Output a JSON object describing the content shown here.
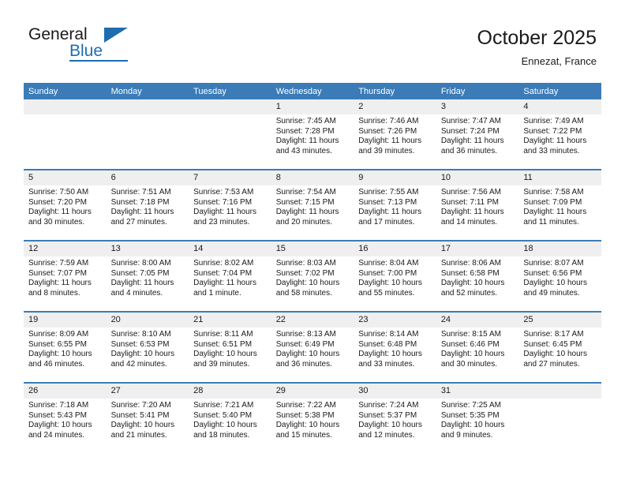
{
  "brand": {
    "name_part1": "General",
    "name_part2": "Blue",
    "accent_color": "#1f6cb0",
    "triangle_icon": "triangle-icon"
  },
  "header": {
    "month_title": "October 2025",
    "location": "Ennezat, France"
  },
  "theme": {
    "header_blue": "#3b7cb8",
    "daynum_gray": "#efefef",
    "text_color": "#1a1a1a"
  },
  "weekday_headers": [
    "Sunday",
    "Monday",
    "Tuesday",
    "Wednesday",
    "Thursday",
    "Friday",
    "Saturday"
  ],
  "calendar": {
    "weeks": [
      [
        {
          "day": "",
          "sunrise": "",
          "sunset": "",
          "daylight1": "",
          "daylight2": "",
          "empty": true
        },
        {
          "day": "",
          "sunrise": "",
          "sunset": "",
          "daylight1": "",
          "daylight2": "",
          "empty": true
        },
        {
          "day": "",
          "sunrise": "",
          "sunset": "",
          "daylight1": "",
          "daylight2": "",
          "empty": true
        },
        {
          "day": "1",
          "sunrise": "Sunrise: 7:45 AM",
          "sunset": "Sunset: 7:28 PM",
          "daylight1": "Daylight: 11 hours",
          "daylight2": "and 43 minutes."
        },
        {
          "day": "2",
          "sunrise": "Sunrise: 7:46 AM",
          "sunset": "Sunset: 7:26 PM",
          "daylight1": "Daylight: 11 hours",
          "daylight2": "and 39 minutes."
        },
        {
          "day": "3",
          "sunrise": "Sunrise: 7:47 AM",
          "sunset": "Sunset: 7:24 PM",
          "daylight1": "Daylight: 11 hours",
          "daylight2": "and 36 minutes."
        },
        {
          "day": "4",
          "sunrise": "Sunrise: 7:49 AM",
          "sunset": "Sunset: 7:22 PM",
          "daylight1": "Daylight: 11 hours",
          "daylight2": "and 33 minutes."
        }
      ],
      [
        {
          "day": "5",
          "sunrise": "Sunrise: 7:50 AM",
          "sunset": "Sunset: 7:20 PM",
          "daylight1": "Daylight: 11 hours",
          "daylight2": "and 30 minutes."
        },
        {
          "day": "6",
          "sunrise": "Sunrise: 7:51 AM",
          "sunset": "Sunset: 7:18 PM",
          "daylight1": "Daylight: 11 hours",
          "daylight2": "and 27 minutes."
        },
        {
          "day": "7",
          "sunrise": "Sunrise: 7:53 AM",
          "sunset": "Sunset: 7:16 PM",
          "daylight1": "Daylight: 11 hours",
          "daylight2": "and 23 minutes."
        },
        {
          "day": "8",
          "sunrise": "Sunrise: 7:54 AM",
          "sunset": "Sunset: 7:15 PM",
          "daylight1": "Daylight: 11 hours",
          "daylight2": "and 20 minutes."
        },
        {
          "day": "9",
          "sunrise": "Sunrise: 7:55 AM",
          "sunset": "Sunset: 7:13 PM",
          "daylight1": "Daylight: 11 hours",
          "daylight2": "and 17 minutes."
        },
        {
          "day": "10",
          "sunrise": "Sunrise: 7:56 AM",
          "sunset": "Sunset: 7:11 PM",
          "daylight1": "Daylight: 11 hours",
          "daylight2": "and 14 minutes."
        },
        {
          "day": "11",
          "sunrise": "Sunrise: 7:58 AM",
          "sunset": "Sunset: 7:09 PM",
          "daylight1": "Daylight: 11 hours",
          "daylight2": "and 11 minutes."
        }
      ],
      [
        {
          "day": "12",
          "sunrise": "Sunrise: 7:59 AM",
          "sunset": "Sunset: 7:07 PM",
          "daylight1": "Daylight: 11 hours",
          "daylight2": "and 8 minutes."
        },
        {
          "day": "13",
          "sunrise": "Sunrise: 8:00 AM",
          "sunset": "Sunset: 7:05 PM",
          "daylight1": "Daylight: 11 hours",
          "daylight2": "and 4 minutes."
        },
        {
          "day": "14",
          "sunrise": "Sunrise: 8:02 AM",
          "sunset": "Sunset: 7:04 PM",
          "daylight1": "Daylight: 11 hours",
          "daylight2": "and 1 minute."
        },
        {
          "day": "15",
          "sunrise": "Sunrise: 8:03 AM",
          "sunset": "Sunset: 7:02 PM",
          "daylight1": "Daylight: 10 hours",
          "daylight2": "and 58 minutes."
        },
        {
          "day": "16",
          "sunrise": "Sunrise: 8:04 AM",
          "sunset": "Sunset: 7:00 PM",
          "daylight1": "Daylight: 10 hours",
          "daylight2": "and 55 minutes."
        },
        {
          "day": "17",
          "sunrise": "Sunrise: 8:06 AM",
          "sunset": "Sunset: 6:58 PM",
          "daylight1": "Daylight: 10 hours",
          "daylight2": "and 52 minutes."
        },
        {
          "day": "18",
          "sunrise": "Sunrise: 8:07 AM",
          "sunset": "Sunset: 6:56 PM",
          "daylight1": "Daylight: 10 hours",
          "daylight2": "and 49 minutes."
        }
      ],
      [
        {
          "day": "19",
          "sunrise": "Sunrise: 8:09 AM",
          "sunset": "Sunset: 6:55 PM",
          "daylight1": "Daylight: 10 hours",
          "daylight2": "and 46 minutes."
        },
        {
          "day": "20",
          "sunrise": "Sunrise: 8:10 AM",
          "sunset": "Sunset: 6:53 PM",
          "daylight1": "Daylight: 10 hours",
          "daylight2": "and 42 minutes."
        },
        {
          "day": "21",
          "sunrise": "Sunrise: 8:11 AM",
          "sunset": "Sunset: 6:51 PM",
          "daylight1": "Daylight: 10 hours",
          "daylight2": "and 39 minutes."
        },
        {
          "day": "22",
          "sunrise": "Sunrise: 8:13 AM",
          "sunset": "Sunset: 6:49 PM",
          "daylight1": "Daylight: 10 hours",
          "daylight2": "and 36 minutes."
        },
        {
          "day": "23",
          "sunrise": "Sunrise: 8:14 AM",
          "sunset": "Sunset: 6:48 PM",
          "daylight1": "Daylight: 10 hours",
          "daylight2": "and 33 minutes."
        },
        {
          "day": "24",
          "sunrise": "Sunrise: 8:15 AM",
          "sunset": "Sunset: 6:46 PM",
          "daylight1": "Daylight: 10 hours",
          "daylight2": "and 30 minutes."
        },
        {
          "day": "25",
          "sunrise": "Sunrise: 8:17 AM",
          "sunset": "Sunset: 6:45 PM",
          "daylight1": "Daylight: 10 hours",
          "daylight2": "and 27 minutes."
        }
      ],
      [
        {
          "day": "26",
          "sunrise": "Sunrise: 7:18 AM",
          "sunset": "Sunset: 5:43 PM",
          "daylight1": "Daylight: 10 hours",
          "daylight2": "and 24 minutes."
        },
        {
          "day": "27",
          "sunrise": "Sunrise: 7:20 AM",
          "sunset": "Sunset: 5:41 PM",
          "daylight1": "Daylight: 10 hours",
          "daylight2": "and 21 minutes."
        },
        {
          "day": "28",
          "sunrise": "Sunrise: 7:21 AM",
          "sunset": "Sunset: 5:40 PM",
          "daylight1": "Daylight: 10 hours",
          "daylight2": "and 18 minutes."
        },
        {
          "day": "29",
          "sunrise": "Sunrise: 7:22 AM",
          "sunset": "Sunset: 5:38 PM",
          "daylight1": "Daylight: 10 hours",
          "daylight2": "and 15 minutes."
        },
        {
          "day": "30",
          "sunrise": "Sunrise: 7:24 AM",
          "sunset": "Sunset: 5:37 PM",
          "daylight1": "Daylight: 10 hours",
          "daylight2": "and 12 minutes."
        },
        {
          "day": "31",
          "sunrise": "Sunrise: 7:25 AM",
          "sunset": "Sunset: 5:35 PM",
          "daylight1": "Daylight: 10 hours",
          "daylight2": "and 9 minutes."
        },
        {
          "day": "",
          "sunrise": "",
          "sunset": "",
          "daylight1": "",
          "daylight2": "",
          "empty": true
        }
      ]
    ]
  }
}
